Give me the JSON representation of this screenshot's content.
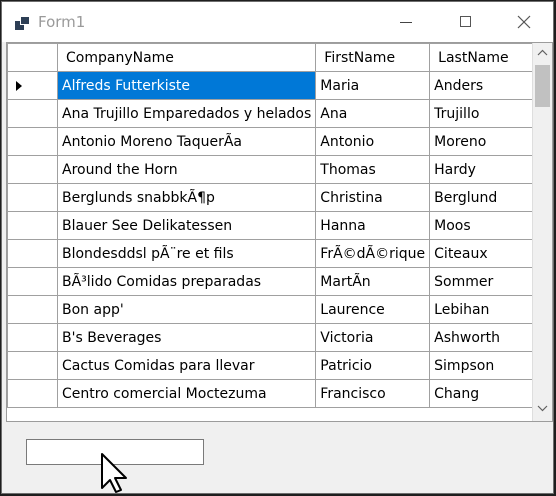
{
  "window": {
    "title": "Form1"
  },
  "grid": {
    "columns": [
      "CompanyName",
      "FirstName",
      "LastName"
    ],
    "rows": [
      [
        "Alfreds Futterkiste",
        "Maria",
        "Anders"
      ],
      [
        "Ana Trujillo Emparedados y helados",
        "Ana",
        "Trujillo"
      ],
      [
        "Antonio Moreno TaquerÃ­a",
        "Antonio",
        "Moreno"
      ],
      [
        "Around the Horn",
        "Thomas",
        "Hardy"
      ],
      [
        "Berglunds snabbkÃ¶p",
        "Christina",
        "Berglund"
      ],
      [
        "Blauer See Delikatessen",
        "Hanna",
        "Moos"
      ],
      [
        "Blondesddsl pÃ¨re et fils",
        "FrÃ©dÃ©rique",
        "Citeaux"
      ],
      [
        "BÃ³lido Comidas preparadas",
        "MartÃ­n",
        "Sommer"
      ],
      [
        "Bon app'",
        "Laurence",
        "Lebihan"
      ],
      [
        "B's Beverages",
        "Victoria",
        "Ashworth"
      ],
      [
        "Cactus Comidas para llevar",
        "Patricio",
        "Simpson"
      ],
      [
        "Centro comercial Moctezuma",
        "Francisco",
        "Chang"
      ]
    ],
    "selected_row": 0
  },
  "textbox": {
    "value": ""
  },
  "icons": {
    "app": "form-app-icon",
    "minimize": "minimize-icon",
    "maximize": "maximize-icon",
    "close": "close-icon",
    "cursor": "mouse-pointer-icon",
    "row_indicator": "row-indicator-arrow-icon"
  },
  "colors": {
    "selection": "#0078d7",
    "grid_line": "#a0a0a0"
  }
}
